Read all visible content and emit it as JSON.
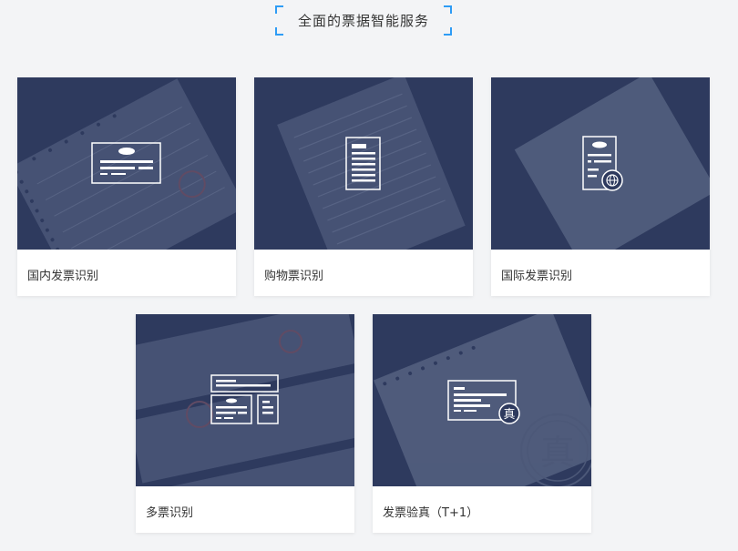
{
  "header": {
    "title": "全面的票据智能服务",
    "bracket_color": "#2e9cf5"
  },
  "cards": [
    {
      "label": "国内发票识别",
      "icon": "domestic-invoice-icon"
    },
    {
      "label": "购物票识别",
      "icon": "shopping-receipt-icon"
    },
    {
      "label": "国际发票识别",
      "icon": "international-invoice-icon"
    },
    {
      "label": "多票识别",
      "icon": "multi-invoice-icon"
    },
    {
      "label": "发票验真（T+1）",
      "icon": "invoice-verify-icon"
    }
  ],
  "verify_stamp_char": "真",
  "colors": {
    "card_image_bg": "#2e3a5e",
    "page_bg": "#f3f4f6"
  }
}
